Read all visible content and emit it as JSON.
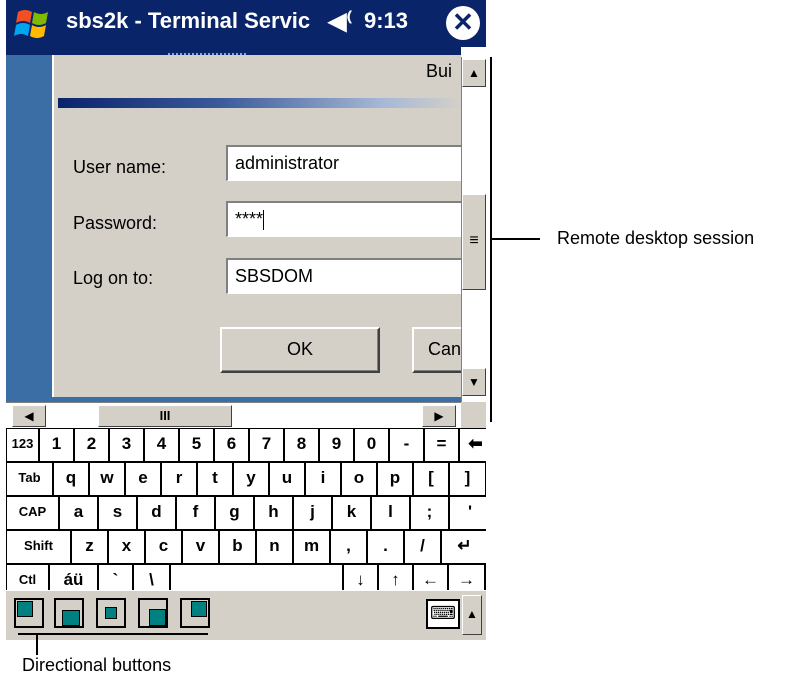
{
  "titlebar": {
    "title": "sbs2k - Terminal Servic",
    "speaker_icon": "speaker-icon",
    "time": "9:13",
    "close_glyph": "✕"
  },
  "dialog": {
    "build_label": "Bui",
    "username_label": "User name:",
    "username_value": "administrator",
    "password_label": "Password:",
    "password_value": "****",
    "logon_label": "Log on to:",
    "logon_value": "SBSDOM",
    "ok_label": "OK",
    "cancel_label": "Can"
  },
  "scroll": {
    "up": "▲",
    "down": "▼",
    "left": "◀",
    "right": "▶",
    "v_thumb": "≡",
    "h_thumb": "III"
  },
  "keyboard": {
    "rows": [
      [
        "123",
        "1",
        "2",
        "3",
        "4",
        "5",
        "6",
        "7",
        "8",
        "9",
        "0",
        "-",
        "=",
        "⬅"
      ],
      [
        "Tab",
        "q",
        "w",
        "e",
        "r",
        "t",
        "y",
        "u",
        "i",
        "o",
        "p",
        "[",
        "]"
      ],
      [
        "CAP",
        "a",
        "s",
        "d",
        "f",
        "g",
        "h",
        "j",
        "k",
        "l",
        ";",
        "'"
      ],
      [
        "Shift",
        "z",
        "x",
        "c",
        "v",
        "b",
        "n",
        "m",
        ",",
        ".",
        "/",
        "↵"
      ],
      [
        "Ctl",
        "áü",
        "`",
        "\\",
        " ",
        "↓",
        "↑",
        "←",
        "→"
      ]
    ]
  },
  "bottombar": {
    "keyboard_icon": "keyboard-icon",
    "menu_arrow": "▲"
  },
  "callouts": {
    "remote": "Remote desktop session",
    "directional": "Directional buttons"
  },
  "colors": {
    "titlebar": "#0a246a",
    "remote_bg": "#3a6ea5",
    "dialog_bg": "#d4d0c8",
    "teal": "#008080"
  }
}
